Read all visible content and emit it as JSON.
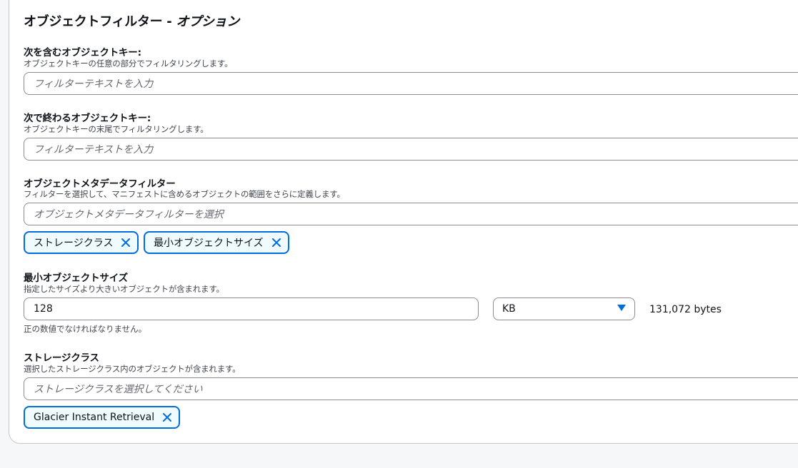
{
  "section": {
    "title_main": "オブジェクトフィルター - ",
    "title_opt": "オプション"
  },
  "prefix": {
    "label": "次を含むオブジェクトキー:",
    "desc": "オブジェクトキーの任意の部分でフィルタリングします。",
    "placeholder": "フィルターテキストを入力"
  },
  "suffix": {
    "label": "次で終わるオブジェクトキー:",
    "desc": "オブジェクトキーの末尾でフィルタリングします。",
    "placeholder": "フィルターテキストを入力"
  },
  "metadata": {
    "label": "オブジェクトメタデータフィルター",
    "desc": "フィルターを選択して、マニフェストに含めるオブジェクトの範囲をさらに定義します。",
    "placeholder": "オブジェクトメタデータフィルターを選択",
    "tokens": [
      "ストレージクラス",
      "最小オブジェクトサイズ"
    ]
  },
  "min_size": {
    "label": "最小オブジェクトサイズ",
    "desc": "指定したサイズより大きいオブジェクトが含まれます。",
    "value": "128",
    "unit": "KB",
    "bytes": "131,072 bytes",
    "hint": "正の数値でなければなりません。"
  },
  "storage_class": {
    "label": "ストレージクラス",
    "desc": "選択したストレージクラス内のオブジェクトが含まれます。",
    "placeholder": "ストレージクラスを選択してください",
    "tokens": [
      "Glacier Instant Retrieval"
    ]
  },
  "colors": {
    "accent": "#006ce0",
    "token_bg": "#f0fbff"
  }
}
